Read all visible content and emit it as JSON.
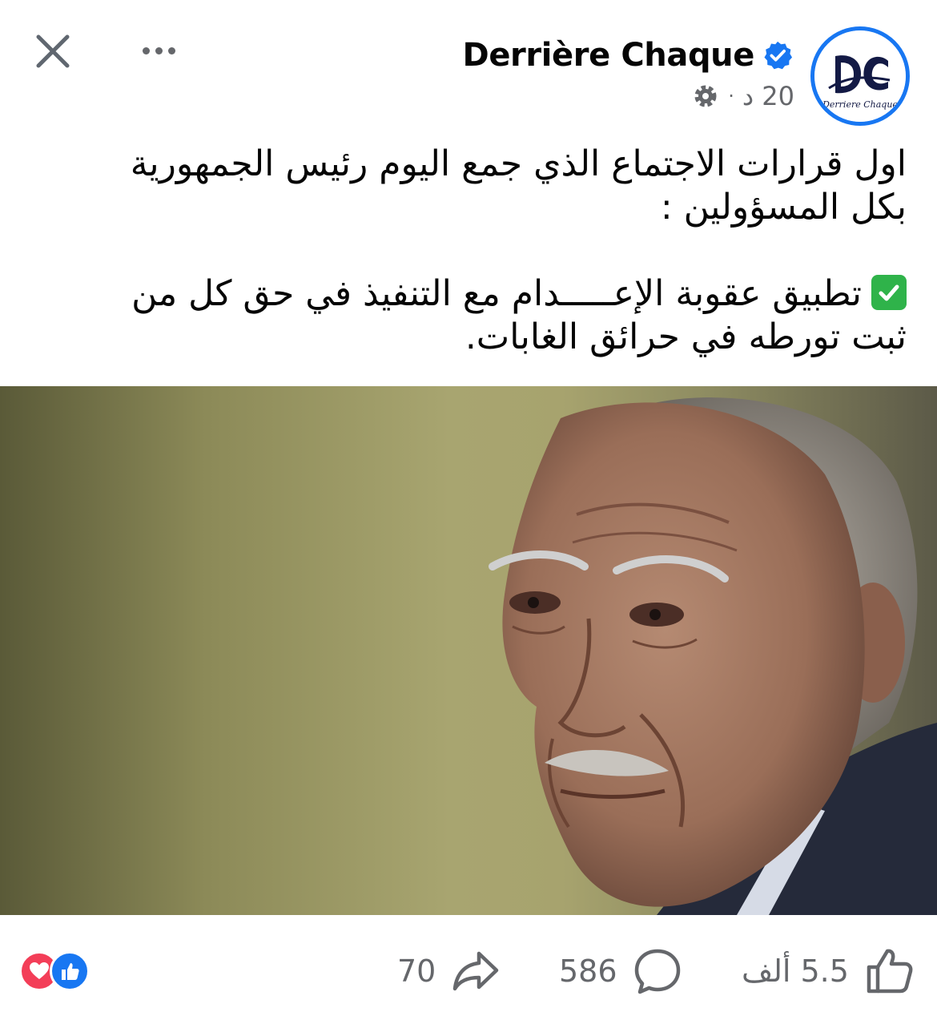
{
  "header": {
    "author_name": "Derrière Chaque",
    "avatar_monogram": "DC",
    "avatar_caption": "Derriere Chaque",
    "timestamp": "20 د",
    "separator": "·",
    "icons": {
      "close": "close-icon",
      "more": "more-options-icon",
      "verified": "verified-badge-icon",
      "audience": "public-gear-icon"
    }
  },
  "post": {
    "paragraph_1": "اول قرارات الاجتماع الذي جمع اليوم رئيس الجمهورية بكل المسؤولين :",
    "paragraph_2": "تطبيق عقوبة الإعـــــدام مع التنفيذ في حق كل من ثبت تورطه في حرائق الغابات.",
    "checkmark_icon": "green-checkmark-icon"
  },
  "footer": {
    "shares": "70",
    "comments": "586",
    "likes_value": "5.5",
    "likes_unit": "ألف",
    "reaction_icons": [
      "love-reaction-icon",
      "like-reaction-icon"
    ]
  },
  "colors": {
    "accent": "#1877f2",
    "text_secondary": "#65676b",
    "love": "#f33e58",
    "check": "#2fb34a"
  }
}
